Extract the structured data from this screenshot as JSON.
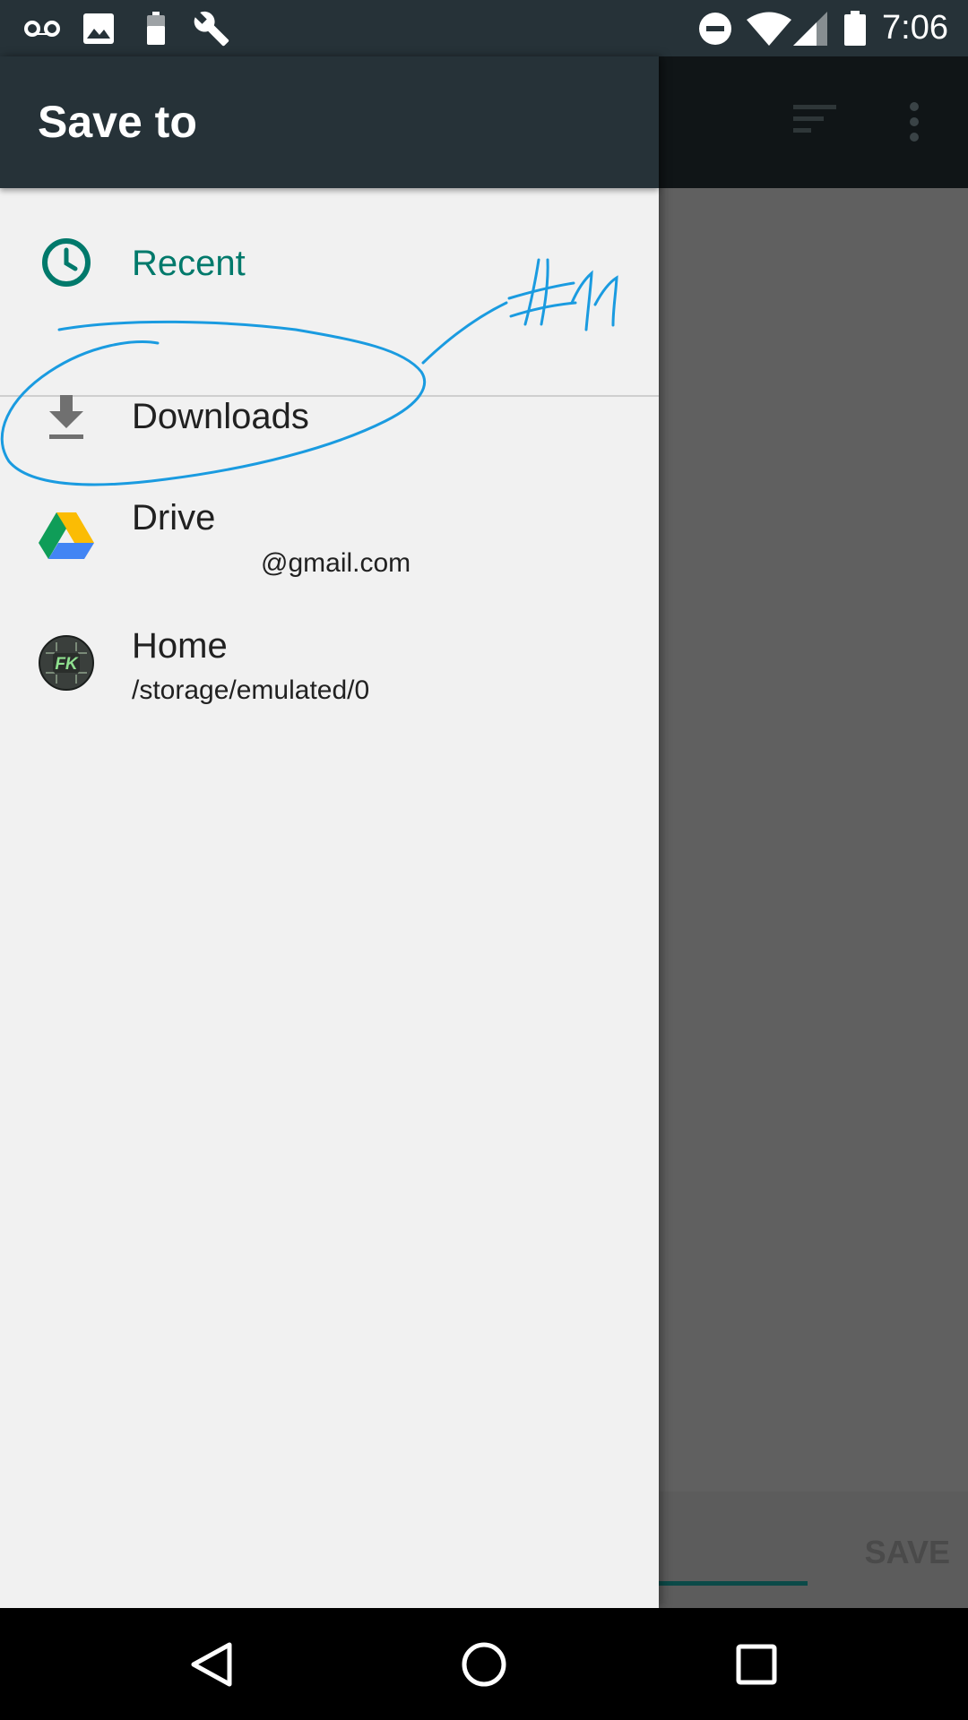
{
  "status_bar": {
    "time": "7:06",
    "left_icons": [
      "voicemail-icon",
      "image-icon",
      "battery-saver-icon",
      "wrench-icon"
    ],
    "right_icons": [
      "do-not-disturb-icon",
      "wifi-icon",
      "cell-signal-icon",
      "battery-icon"
    ]
  },
  "drawer": {
    "title": "Save to",
    "items": [
      {
        "label": "Recent",
        "subtitle": "",
        "icon": "clock-icon",
        "color": "#00796b",
        "active": true
      },
      {
        "label": "Downloads",
        "subtitle": "",
        "icon": "download-icon"
      },
      {
        "label": "Drive",
        "subtitle": "@gmail.com",
        "icon": "google-drive-icon"
      },
      {
        "label": "Home",
        "subtitle": "/storage/emulated/0",
        "icon": "fk-app-icon"
      }
    ],
    "fk_logo_text": "FK"
  },
  "background": {
    "save_label": "SAVE",
    "toolbar_icons": [
      "sort-icon",
      "overflow-menu-icon"
    ]
  },
  "annotation": {
    "text": "#11",
    "color": "#1a9be0"
  },
  "nav_bar": {
    "buttons": [
      "back-icon",
      "home-icon",
      "recents-icon"
    ]
  }
}
